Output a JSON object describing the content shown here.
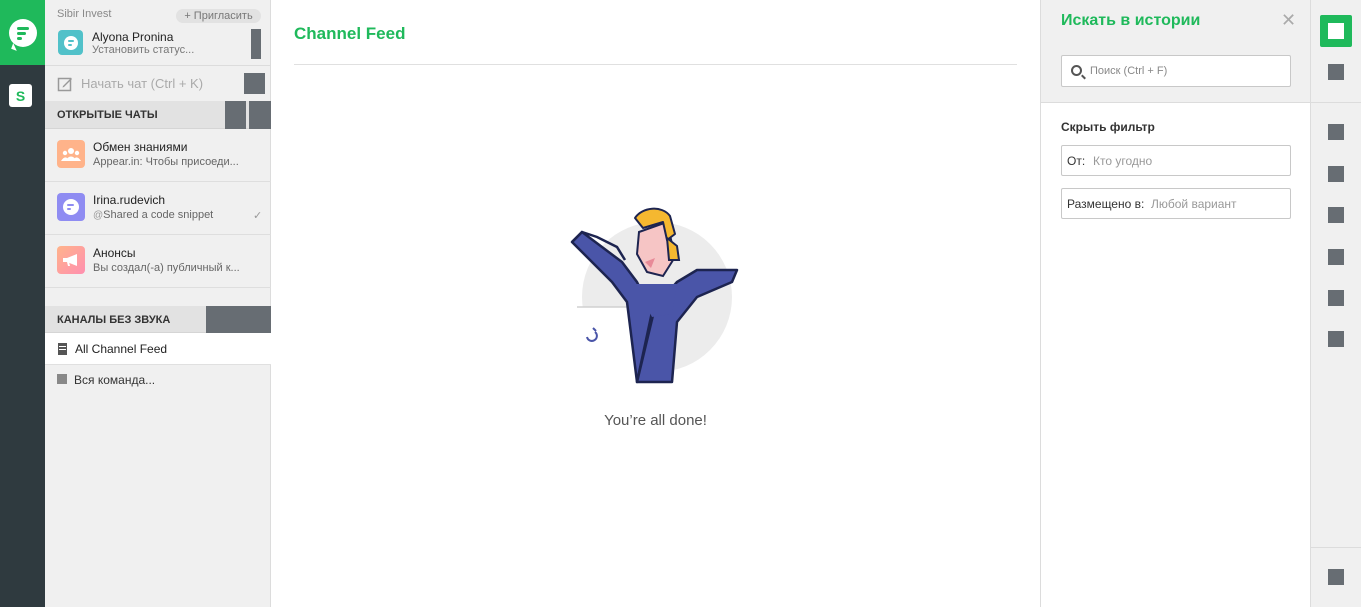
{
  "rail": {
    "workspace_letter": "S"
  },
  "sidebar": {
    "team_name": "Sibir Invest",
    "invite_label": "+ Пригласить",
    "user": {
      "name": "Alyona Pronina",
      "status": "Установить статус..."
    },
    "start_chat": {
      "label": "Начать чат (Ctrl + K)"
    },
    "open_chats": {
      "title": "ОТКРЫТЫЕ ЧАТЫ",
      "items": [
        {
          "name": "Обмен знаниями",
          "preview": "Appear.in: Чтобы присоеди...",
          "avatar_color": "#ffb38a",
          "icon": "group-icon"
        },
        {
          "name": "Irina.rudevich",
          "preview": "Shared a code snippet",
          "preview_icon": "@",
          "read_mark": "✓",
          "avatar_color": "#8f8cf2",
          "icon": "chat-bubble-icon"
        },
        {
          "name": "Анонсы",
          "preview": "Вы создал(-а) публичный к...",
          "avatar_color": "#ff9aa6",
          "icon": "megaphone-icon"
        }
      ]
    },
    "muted": {
      "title": "КАНАЛЫ БЕЗ ЗВУКА",
      "feed_label": "All Channel Feed",
      "team_label": "Вся команда..."
    }
  },
  "main": {
    "title": "Channel Feed",
    "empty_text": "You’re all done!"
  },
  "search": {
    "title": "Искать в истории",
    "close": "✕",
    "placeholder": "Поиск (Ctrl + F)",
    "filter_toggle": "Скрыть фильтр",
    "from_label": "От:",
    "from_value": "Кто угодно",
    "posted_in_label": "Размещено в:",
    "posted_in_value": "Любой вариант"
  },
  "colors": {
    "accent": "#1fb95b",
    "rail": "#2f3a3f",
    "placeholder_block": "#676d73"
  }
}
